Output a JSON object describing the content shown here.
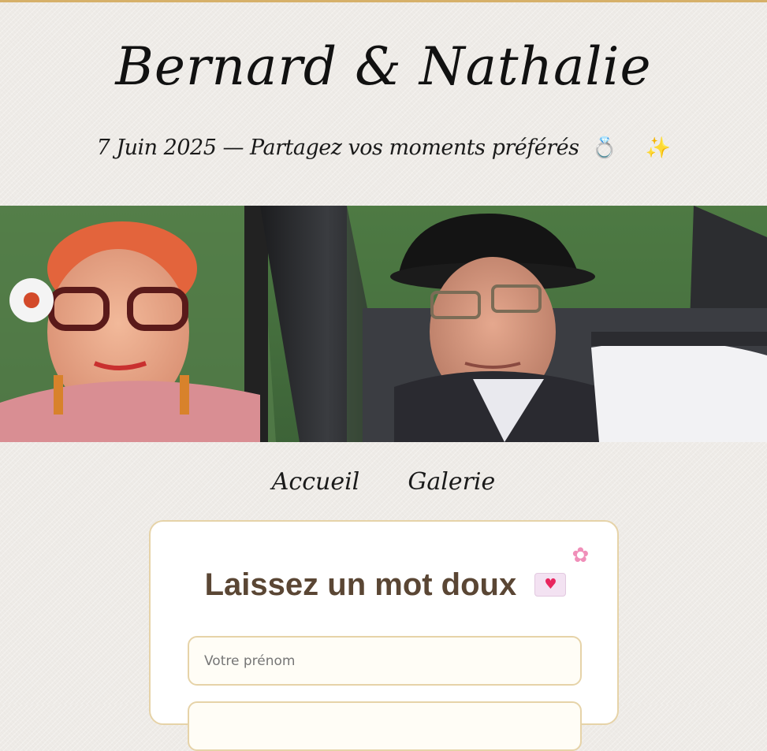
{
  "header": {
    "title": "Bernard & Nathalie",
    "subtitle": "7 Juin 2025 — Partagez vos moments préférés",
    "subtitle_emojis": [
      "ring-emoji",
      "sparkles-emoji"
    ]
  },
  "hero": {
    "image": "photo-of-couple-in-vintage-car"
  },
  "nav": {
    "items": [
      {
        "label": "Accueil"
      },
      {
        "label": "Galerie"
      }
    ]
  },
  "form": {
    "title": "Laissez un mot doux",
    "title_icons": [
      "love-letter-icon",
      "flower-icon"
    ],
    "name_placeholder": "Votre prénom",
    "message_placeholder": ""
  },
  "colors": {
    "accent_gold": "#d6b069",
    "card_border": "#e6d3a8",
    "title_brown": "#5a4634",
    "background": "#eeebe7"
  }
}
